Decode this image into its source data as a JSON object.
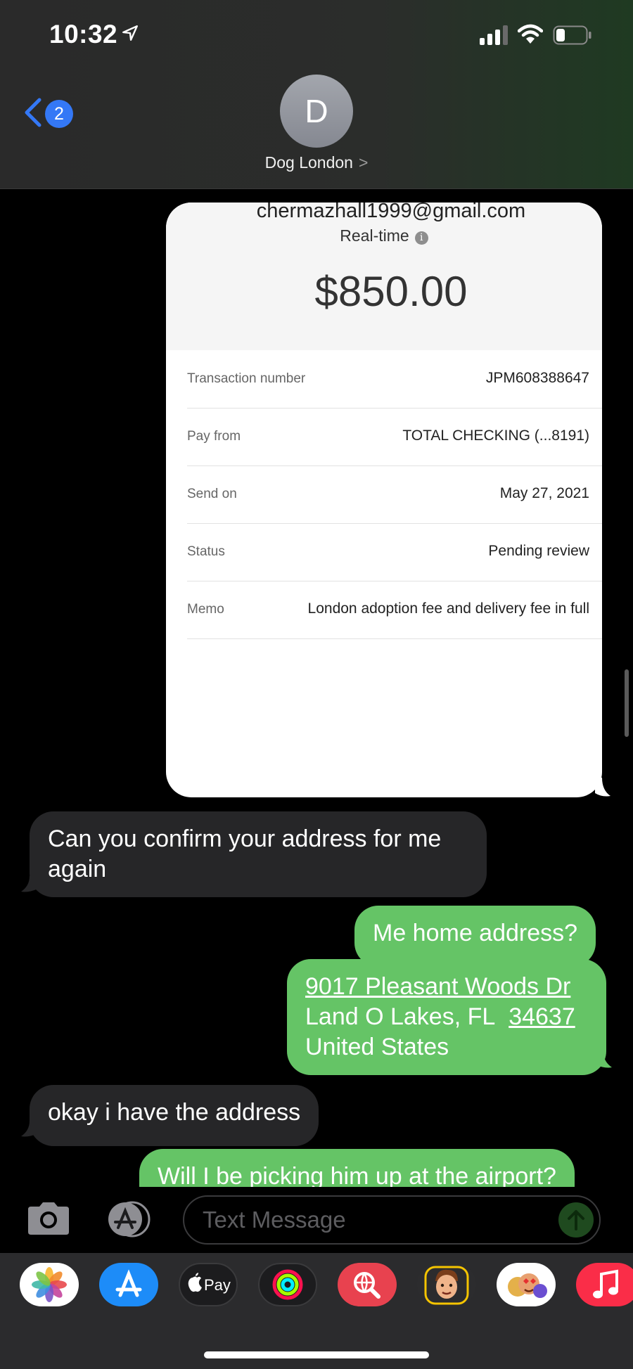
{
  "status_bar": {
    "time": "10:32"
  },
  "nav": {
    "back_badge": "2",
    "avatar_initial": "D",
    "contact_name": "Dog London",
    "contact_chevron": ">"
  },
  "receipt": {
    "email": "chermazhall1999@gmail.com",
    "payment_type": "Real-time",
    "amount": "$850.00",
    "rows": [
      {
        "label": "Transaction number",
        "value": "JPM608388647"
      },
      {
        "label": "Pay from",
        "value": "TOTAL CHECKING (...8191)"
      },
      {
        "label": "Send on",
        "value": "May 27, 2021"
      },
      {
        "label": "Status",
        "value": "Pending review"
      },
      {
        "label": "Memo",
        "value": "London  adoption fee and delivery fee in full"
      }
    ]
  },
  "messages": [
    {
      "direction": "incoming",
      "text": "Can you confirm your address for me again"
    },
    {
      "direction": "outgoing",
      "text": "Me home address?"
    },
    {
      "direction": "outgoing",
      "lines": [
        "9017 Pleasant Woods Dr",
        "Land O Lakes, FL",
        "34637",
        "United States"
      ]
    },
    {
      "direction": "incoming",
      "text": "okay i have the address"
    },
    {
      "direction": "outgoing",
      "text": "Will I be picking him up at the airport?"
    }
  ],
  "composer": {
    "placeholder": "Text Message"
  },
  "app_drawer": {
    "apps": [
      {
        "name": "Photos",
        "icon": "photos-icon"
      },
      {
        "name": "App Store",
        "icon": "app-store-icon"
      },
      {
        "name": "Apple Pay",
        "icon": "apple-pay-icon",
        "label": "Pay"
      },
      {
        "name": "Activity",
        "icon": "activity-rings-icon"
      },
      {
        "name": "Web Images",
        "icon": "globe-search-icon"
      },
      {
        "name": "Memoji",
        "icon": "memoji-icon"
      },
      {
        "name": "Memoji Stickers",
        "icon": "memoji-stickers-icon"
      },
      {
        "name": "Music",
        "icon": "music-note-icon"
      }
    ]
  },
  "colors": {
    "outgoing": "#65c466",
    "incoming": "#262628",
    "accent": "#3478f6"
  }
}
